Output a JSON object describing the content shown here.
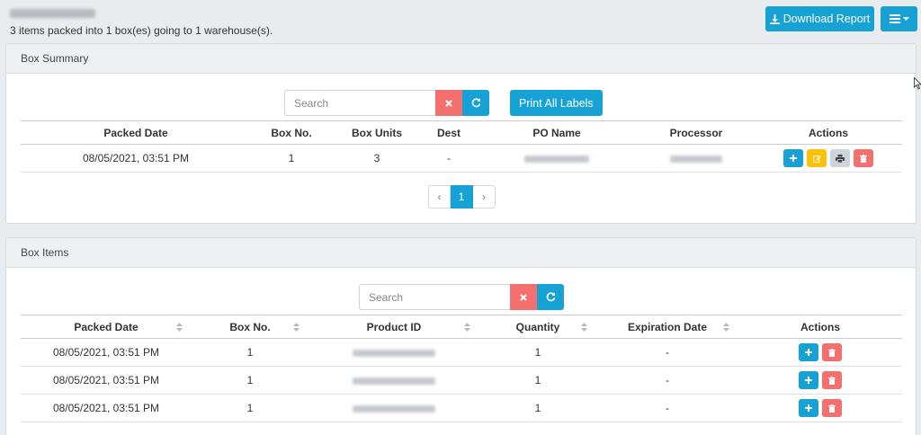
{
  "header": {
    "summary": "3 items packed into 1 box(es) going to 1 warehouse(s).",
    "download_label": "Download Report"
  },
  "box_summary": {
    "title": "Box Summary",
    "search_placeholder": "Search",
    "print_all_label": "Print All Labels",
    "columns": [
      "Packed Date",
      "Box No.",
      "Box Units",
      "Dest",
      "PO Name",
      "Processor",
      "Actions"
    ],
    "rows": [
      {
        "packed_date": "08/05/2021, 03:51 PM",
        "box_no": "1",
        "box_units": "3",
        "dest": "-"
      }
    ],
    "pagination": {
      "prev": "‹",
      "current": "1",
      "next": "›"
    }
  },
  "box_items": {
    "title": "Box Items",
    "search_placeholder": "Search",
    "columns": [
      "Packed Date",
      "Box No.",
      "Product ID",
      "Quantity",
      "Expiration Date",
      "Actions"
    ],
    "rows": [
      {
        "packed_date": "08/05/2021, 03:51 PM",
        "box_no": "1",
        "quantity": "1",
        "expiration": "-"
      },
      {
        "packed_date": "08/05/2021, 03:51 PM",
        "box_no": "1",
        "quantity": "1",
        "expiration": "-"
      },
      {
        "packed_date": "08/05/2021, 03:51 PM",
        "box_no": "1",
        "quantity": "1",
        "expiration": "-"
      }
    ]
  },
  "colors": {
    "primary": "#17a2d6",
    "danger": "#f3706f",
    "warning": "#ffc107",
    "secondary": "#ced4da"
  }
}
